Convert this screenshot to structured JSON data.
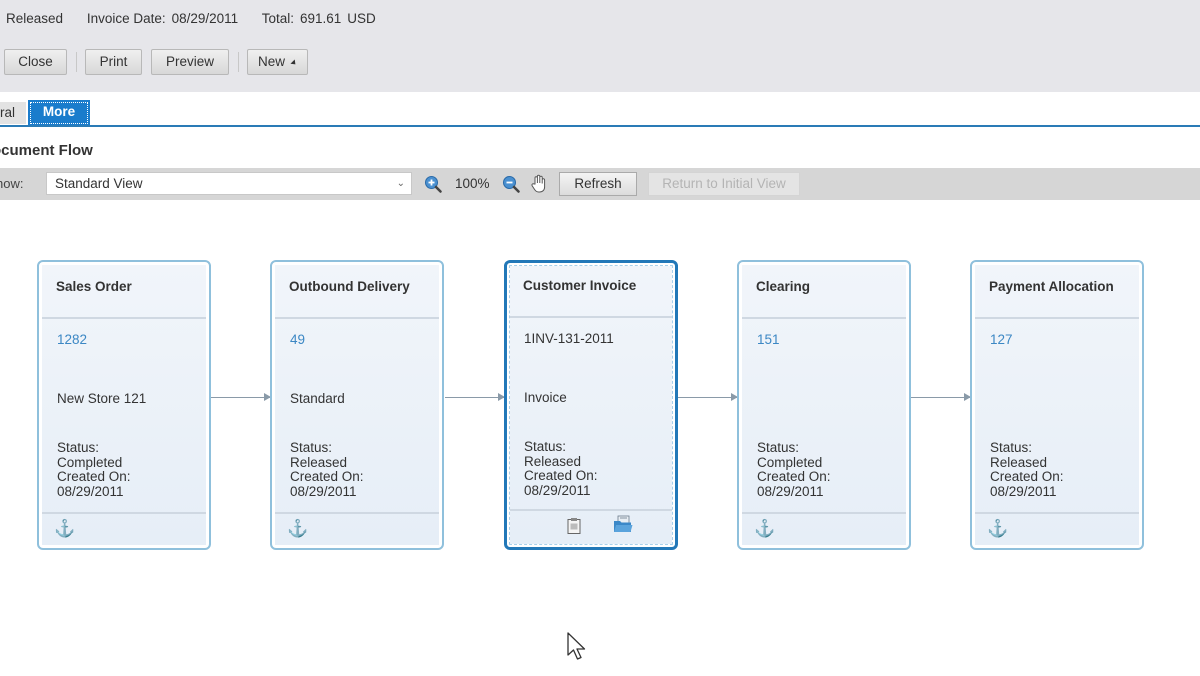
{
  "header": {
    "status": "Released",
    "invoice_date_label": "Invoice Date:",
    "invoice_date": "08/29/2011",
    "total_label": "Total:",
    "total_value": "691.61",
    "currency": "USD"
  },
  "actions": {
    "close": "Close",
    "print": "Print",
    "preview": "Preview",
    "new": "New"
  },
  "tabs": [
    {
      "label": "General",
      "visible_label": "ral",
      "active": false
    },
    {
      "label": "More",
      "active": true
    }
  ],
  "section": {
    "title": "Document Flow",
    "visible_title": "ocument Flow"
  },
  "toolbar": {
    "show_label": "Show:",
    "show_visible": "how:",
    "view_selected": "Standard View",
    "zoom_level": "100%",
    "refresh": "Refresh",
    "return_to_initial": "Return to Initial View",
    "icons": [
      "zoom-in-icon",
      "zoom-out-icon",
      "hand-pan-icon"
    ]
  },
  "nodes": [
    {
      "title": "Sales Order",
      "id": "1282",
      "id_link": true,
      "description": "New Store 121",
      "status_label": "Status:",
      "status": "Completed",
      "created_label": "Created On:",
      "created_on": "08/29/2011",
      "footer_icons": [
        "anchor-icon"
      ],
      "selected": false
    },
    {
      "title": "Outbound Delivery",
      "id": "49",
      "id_link": true,
      "description": "Standard",
      "status_label": "Status:",
      "status": "Released",
      "created_label": "Created On:",
      "created_on": "08/29/2011",
      "footer_icons": [
        "anchor-icon"
      ],
      "selected": false
    },
    {
      "title": "Customer Invoice",
      "id": "1INV-131-2011",
      "id_link": false,
      "description": "Invoice",
      "status_label": "Status:",
      "status": "Released",
      "created_label": "Created On:",
      "created_on": "08/29/2011",
      "footer_icons": [
        "clipboard-icon",
        "folder-icon"
      ],
      "selected": true
    },
    {
      "title": "Clearing",
      "id": "151",
      "id_link": true,
      "description": "",
      "status_label": "Status:",
      "status": "Completed",
      "created_label": "Created On:",
      "created_on": "08/29/2011",
      "footer_icons": [
        "anchor-icon"
      ],
      "selected": false
    },
    {
      "title": "Payment Allocation",
      "id": "127",
      "id_link": true,
      "description": "",
      "status_label": "Status:",
      "status": "Released",
      "created_label": "Created On:",
      "created_on": "08/29/2011",
      "footer_icons": [
        "anchor-icon"
      ],
      "selected": false
    }
  ],
  "colors": {
    "accent": "#1a7ccc",
    "link": "#3b87c4",
    "node_border": "#8fc0dc",
    "selected_border": "#2278b8"
  }
}
